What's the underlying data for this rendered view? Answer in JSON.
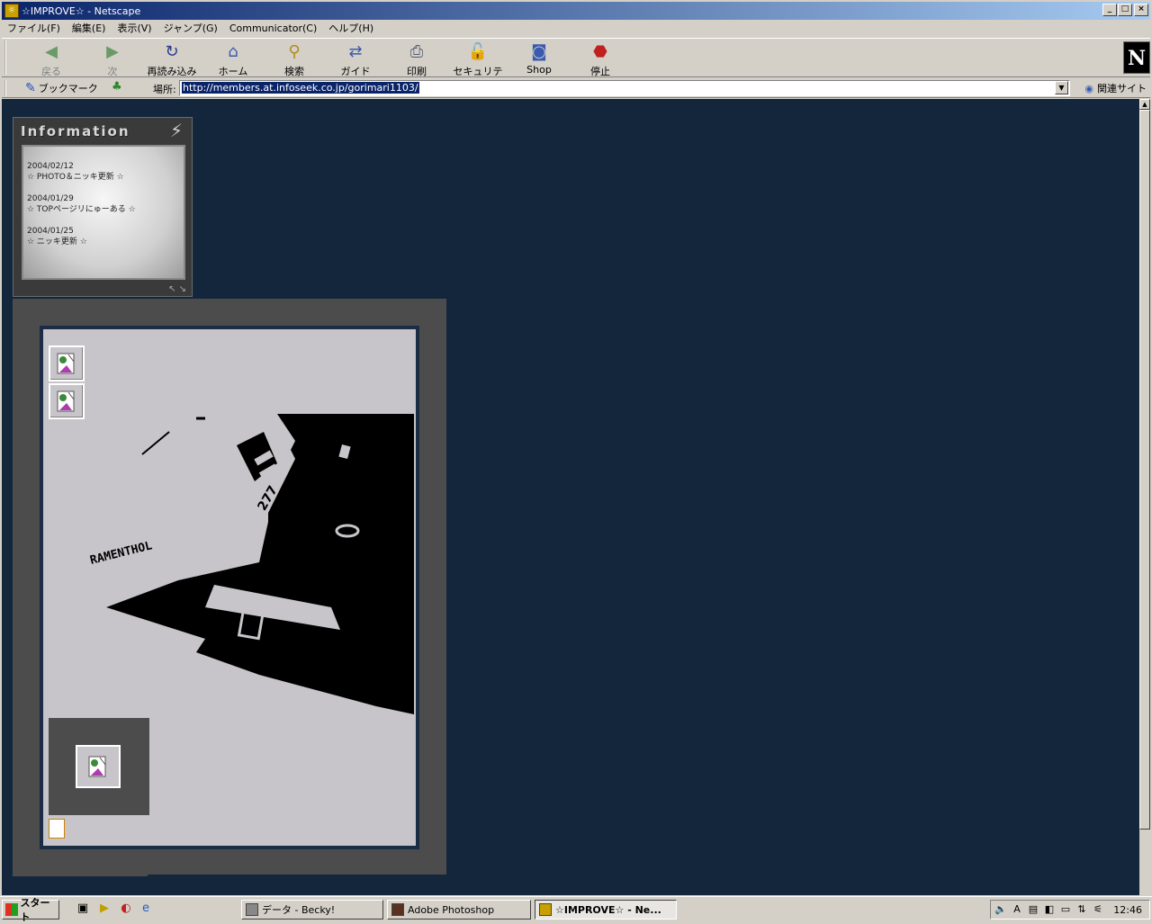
{
  "window": {
    "title": "☆IMPROVE☆ - Netscape"
  },
  "menu": [
    "ファイル(F)",
    "編集(E)",
    "表示(V)",
    "ジャンプ(G)",
    "Communicator(C)",
    "ヘルプ(H)"
  ],
  "toolbar": {
    "back": "戻る",
    "forward": "次",
    "reload": "再読み込み",
    "home": "ホーム",
    "search": "検索",
    "guide": "ガイド",
    "print": "印刷",
    "security": "セキュリティ",
    "shop": "Shop",
    "stop": "停止"
  },
  "location": {
    "bookmarks_label": "ブックマーク",
    "label": "場所:",
    "url": "http://members.at.infoseek.co.jp/gorimari1103/",
    "related": "関連サイト"
  },
  "info": {
    "heading": "Information",
    "entries": [
      {
        "date": "2004/02/12",
        "text": "☆ PHOTO＆ニッキ更新 ☆"
      },
      {
        "date": "2004/01/29",
        "text": "☆ TOPページリにゅーある ☆"
      },
      {
        "date": "2004/01/25",
        "text": "☆ ニッキ更新 ☆"
      }
    ]
  },
  "photo": {
    "text1": "RAMENTHOL",
    "text2": "277"
  },
  "taskbar": {
    "start": "スタート",
    "tasks": [
      "データ - Becky!",
      "Adobe Photoshop",
      "☆IMPROVE☆ - Ne..."
    ],
    "clock": "12:46"
  },
  "colors": {
    "page_bg": "#13263c",
    "frame": "#4c4c4c",
    "title_start": "#0a246a",
    "title_end": "#a6caf0"
  }
}
